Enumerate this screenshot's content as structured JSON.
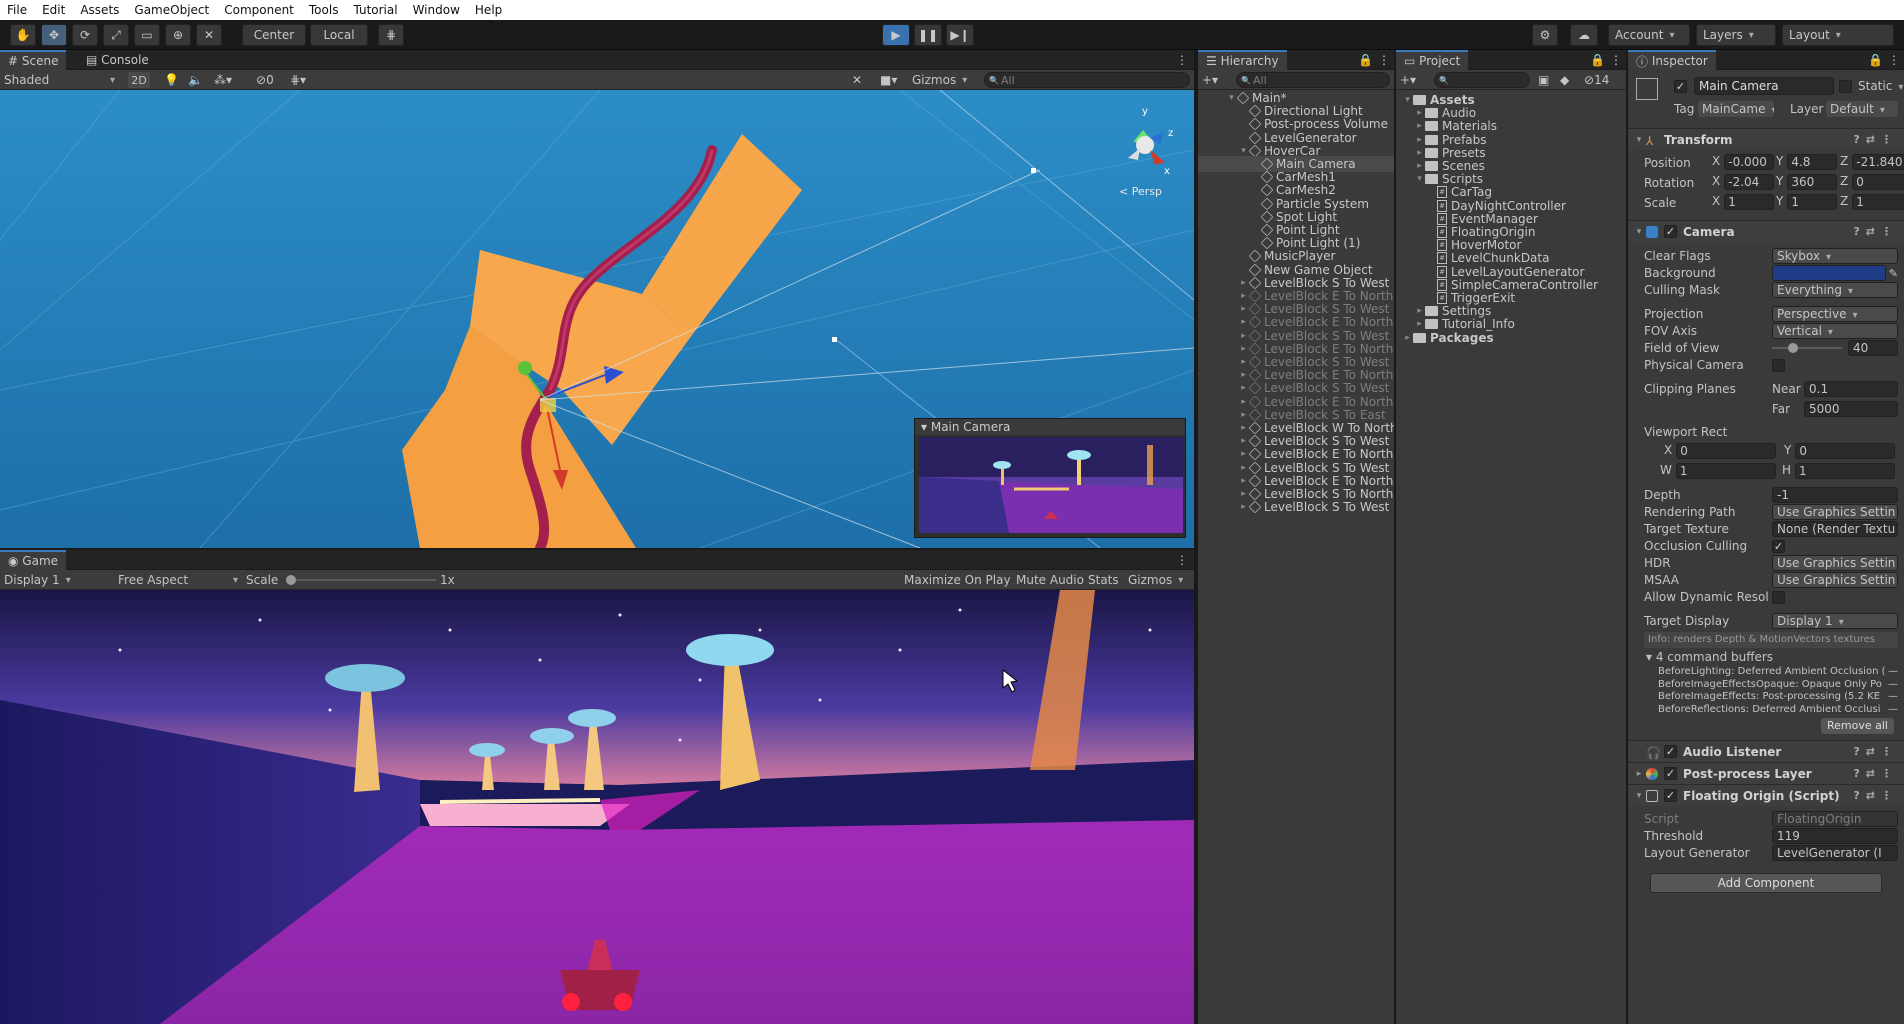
{
  "menu": [
    "File",
    "Edit",
    "Assets",
    "GameObject",
    "Component",
    "Tools",
    "Tutorial",
    "Window",
    "Help"
  ],
  "toolbar": {
    "pivot": "Center",
    "space": "Local",
    "account": "Account",
    "layers": "Layers",
    "layout": "Layout"
  },
  "scene_panel": {
    "tabs": [
      "Scene",
      "Console"
    ],
    "shading": "Shaded",
    "mode_2d": "2D",
    "hidden_count": "0",
    "gizmos": "Gizmos",
    "search_placeholder": "All",
    "persp_label": "< Persp",
    "camera_preview_title": "Main Camera"
  },
  "game_panel": {
    "tab": "Game",
    "display": "Display 1",
    "aspect": "Free Aspect",
    "scale_label": "Scale",
    "scale_value": "1x",
    "maximize": "Maximize On Play",
    "mute": "Mute Audio",
    "stats": "Stats",
    "gizmos": "Gizmos"
  },
  "hierarchy": {
    "title": "Hierarchy",
    "search_placeholder": "All",
    "items": [
      {
        "label": "Main*",
        "depth": 0,
        "arrow": "open",
        "kind": "scene",
        "dim": false
      },
      {
        "label": "Directional Light",
        "depth": 1,
        "arrow": "",
        "dim": false
      },
      {
        "label": "Post-process Volume",
        "depth": 1,
        "arrow": "",
        "dim": false
      },
      {
        "label": "LevelGenerator",
        "depth": 1,
        "arrow": "",
        "dim": false
      },
      {
        "label": "HoverCar",
        "depth": 1,
        "arrow": "open",
        "dim": false
      },
      {
        "label": "Main Camera",
        "depth": 2,
        "arrow": "",
        "dim": false,
        "selected": true
      },
      {
        "label": "CarMesh1",
        "depth": 2,
        "arrow": "",
        "dim": false
      },
      {
        "label": "CarMesh2",
        "depth": 2,
        "arrow": "",
        "dim": false
      },
      {
        "label": "Particle System",
        "depth": 2,
        "arrow": "",
        "dim": false
      },
      {
        "label": "Spot Light",
        "depth": 2,
        "arrow": "",
        "dim": false
      },
      {
        "label": "Point Light",
        "depth": 2,
        "arrow": "",
        "dim": false
      },
      {
        "label": "Point Light (1)",
        "depth": 2,
        "arrow": "",
        "dim": false
      },
      {
        "label": "MusicPlayer",
        "depth": 1,
        "arrow": "",
        "dim": false
      },
      {
        "label": "New Game Object",
        "depth": 1,
        "arrow": "",
        "dim": false
      },
      {
        "label": "LevelBlock S To West",
        "depth": 1,
        "arrow": "closed",
        "dim": false
      },
      {
        "label": "LevelBlock E To North",
        "depth": 1,
        "arrow": "closed",
        "dim": true
      },
      {
        "label": "LevelBlock S To West",
        "depth": 1,
        "arrow": "closed",
        "dim": true
      },
      {
        "label": "LevelBlock E To North",
        "depth": 1,
        "arrow": "closed",
        "dim": true
      },
      {
        "label": "LevelBlock S To West",
        "depth": 1,
        "arrow": "closed",
        "dim": true
      },
      {
        "label": "LevelBlock E To North",
        "depth": 1,
        "arrow": "closed",
        "dim": true
      },
      {
        "label": "LevelBlock S To West",
        "depth": 1,
        "arrow": "closed",
        "dim": true
      },
      {
        "label": "LevelBlock E To North",
        "depth": 1,
        "arrow": "closed",
        "dim": true
      },
      {
        "label": "LevelBlock S To West",
        "depth": 1,
        "arrow": "closed",
        "dim": true
      },
      {
        "label": "LevelBlock E To North",
        "depth": 1,
        "arrow": "closed",
        "dim": true
      },
      {
        "label": "LevelBlock S To East",
        "depth": 1,
        "arrow": "closed",
        "dim": true
      },
      {
        "label": "LevelBlock W To North",
        "depth": 1,
        "arrow": "closed",
        "dim": false
      },
      {
        "label": "LevelBlock S To West",
        "depth": 1,
        "arrow": "closed",
        "dim": false
      },
      {
        "label": "LevelBlock E To North",
        "depth": 1,
        "arrow": "closed",
        "dim": false
      },
      {
        "label": "LevelBlock S To West",
        "depth": 1,
        "arrow": "closed",
        "dim": false
      },
      {
        "label": "LevelBlock E To North",
        "depth": 1,
        "arrow": "closed",
        "dim": false
      },
      {
        "label": "LevelBlock S To North",
        "depth": 1,
        "arrow": "closed",
        "dim": false
      },
      {
        "label": "LevelBlock S To West",
        "depth": 1,
        "arrow": "closed",
        "dim": false
      }
    ]
  },
  "project": {
    "title": "Project",
    "hidden_count": "14",
    "items": [
      {
        "label": "Assets",
        "depth": 0,
        "arrow": "open",
        "kind": "folder",
        "bold": true
      },
      {
        "label": "Audio",
        "depth": 1,
        "arrow": "closed",
        "kind": "folder"
      },
      {
        "label": "Materials",
        "depth": 1,
        "arrow": "closed",
        "kind": "folder"
      },
      {
        "label": "Prefabs",
        "depth": 1,
        "arrow": "closed",
        "kind": "folder"
      },
      {
        "label": "Presets",
        "depth": 1,
        "arrow": "closed",
        "kind": "folder"
      },
      {
        "label": "Scenes",
        "depth": 1,
        "arrow": "closed",
        "kind": "folder"
      },
      {
        "label": "Scripts",
        "depth": 1,
        "arrow": "open",
        "kind": "folder"
      },
      {
        "label": "CarTag",
        "depth": 2,
        "arrow": "",
        "kind": "script"
      },
      {
        "label": "DayNightController",
        "depth": 2,
        "arrow": "",
        "kind": "script"
      },
      {
        "label": "EventManager",
        "depth": 2,
        "arrow": "",
        "kind": "script"
      },
      {
        "label": "FloatingOrigin",
        "depth": 2,
        "arrow": "",
        "kind": "script"
      },
      {
        "label": "HoverMotor",
        "depth": 2,
        "arrow": "",
        "kind": "script"
      },
      {
        "label": "LevelChunkData",
        "depth": 2,
        "arrow": "",
        "kind": "script"
      },
      {
        "label": "LevelLayoutGenerator",
        "depth": 2,
        "arrow": "",
        "kind": "script"
      },
      {
        "label": "SimpleCameraController",
        "depth": 2,
        "arrow": "",
        "kind": "script"
      },
      {
        "label": "TriggerExit",
        "depth": 2,
        "arrow": "",
        "kind": "script"
      },
      {
        "label": "Settings",
        "depth": 1,
        "arrow": "closed",
        "kind": "folder"
      },
      {
        "label": "Tutorial_Info",
        "depth": 1,
        "arrow": "closed",
        "kind": "folder"
      },
      {
        "label": "Packages",
        "depth": 0,
        "arrow": "closed",
        "kind": "folder",
        "bold": true
      }
    ]
  },
  "inspector": {
    "title": "Inspector",
    "object_name": "Main Camera",
    "static_label": "Static",
    "tag_label": "Tag",
    "tag_value": "MainCame",
    "layer_label": "Layer",
    "layer_value": "Default",
    "transform": {
      "title": "Transform",
      "position_label": "Position",
      "position": [
        "-0.000",
        "4.8",
        "-21.840"
      ],
      "rotation_label": "Rotation",
      "rotation": [
        "-2.04",
        "360",
        "0"
      ],
      "scale_label": "Scale",
      "scale": [
        "1",
        "1",
        "1"
      ]
    },
    "camera": {
      "title": "Camera",
      "clear_flags_label": "Clear Flags",
      "clear_flags": "Skybox",
      "background_label": "Background",
      "background_color": "#1f3d86",
      "culling_mask_label": "Culling Mask",
      "culling_mask": "Everything",
      "projection_label": "Projection",
      "projection": "Perspective",
      "fov_axis_label": "FOV Axis",
      "fov_axis": "Vertical",
      "fov_label": "Field of View",
      "fov": "40",
      "physical_label": "Physical Camera",
      "clipping_label": "Clipping Planes",
      "near_label": "Near",
      "near": "0.1",
      "far_label": "Far",
      "far": "5000",
      "viewport_label": "Viewport Rect",
      "vx": "0",
      "vy": "0",
      "vw": "1",
      "vh": "1",
      "depth_label": "Depth",
      "depth": "-1",
      "rendering_path_label": "Rendering Path",
      "rendering_path": "Use Graphics Settin",
      "target_texture_label": "Target Texture",
      "target_texture": "None (Render Textu",
      "occlusion_label": "Occlusion Culling",
      "hdr_label": "HDR",
      "hdr": "Use Graphics Settin",
      "msaa_label": "MSAA",
      "msaa": "Use Graphics Settin",
      "dynamic_res_label": "Allow Dynamic Resol",
      "target_display_label": "Target Display",
      "target_display": "Display 1",
      "info": "Info: renders Depth & MotionVectors textures",
      "buffers_title": "4 command buffers",
      "buffers": [
        "BeforeLighting: Deferred Ambient Occlusion (",
        "BeforeImageEffectsOpaque: Opaque Only Po",
        "BeforeImageEffects: Post-processing (5.2 KE",
        "BeforeReflections: Deferred Ambient Occlusi"
      ],
      "remove_all": "Remove all"
    },
    "audio_listener": "Audio Listener",
    "post_process_layer": "Post-process Layer",
    "floating_origin": {
      "title": "Floating Origin (Script)",
      "script_label": "Script",
      "script": "FloatingOrigin",
      "threshold_label": "Threshold",
      "threshold": "119",
      "layout_gen_label": "Layout Generator",
      "layout_gen": "LevelGenerator (I"
    },
    "add_component": "Add Component"
  }
}
